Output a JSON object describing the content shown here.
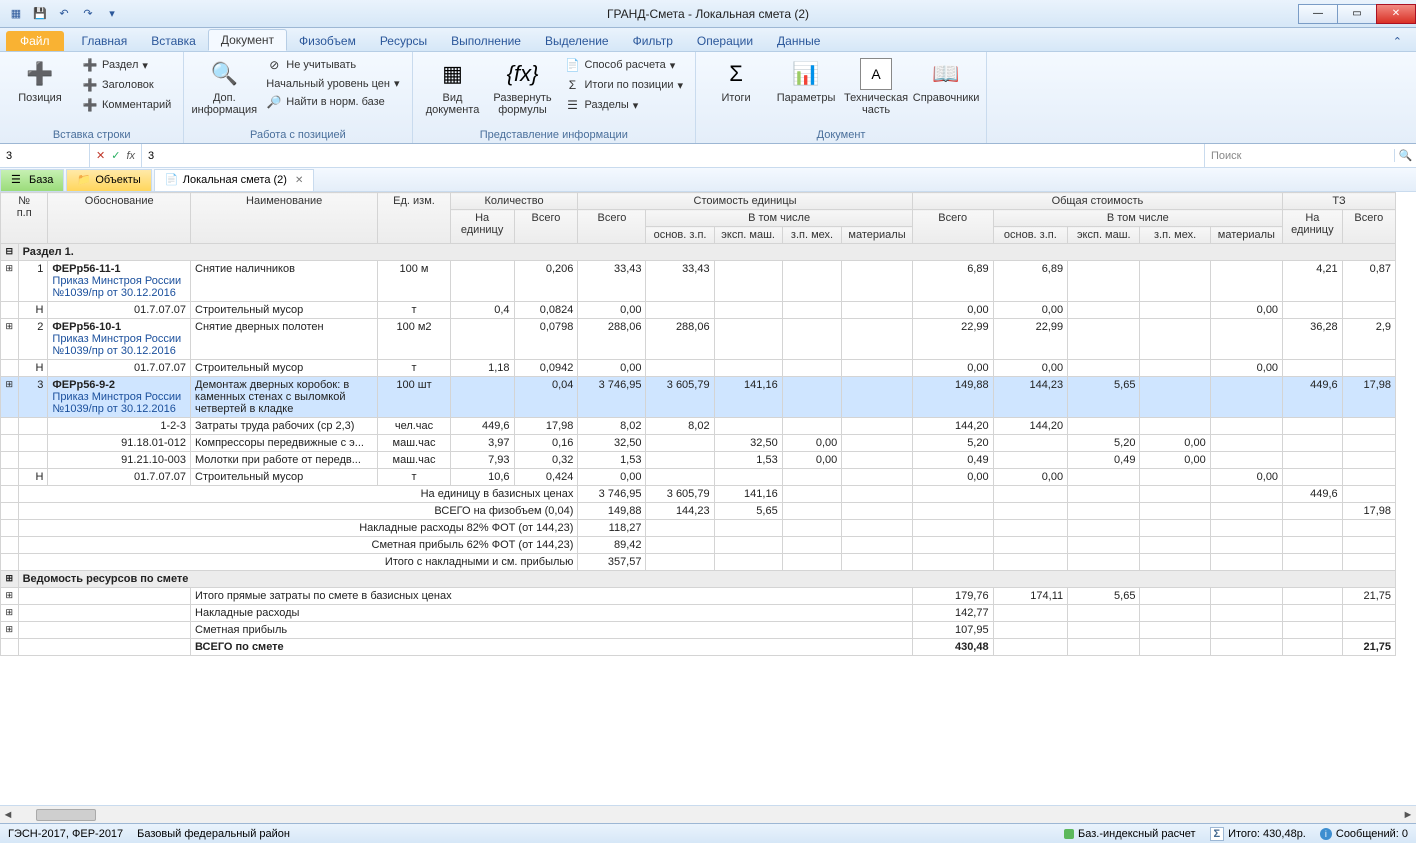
{
  "title": "ГРАНД-Смета - Локальная смета (2)",
  "ribbon_tabs": {
    "file": "Файл",
    "items": [
      "Главная",
      "Вставка",
      "Документ",
      "Физобъем",
      "Ресурсы",
      "Выполнение",
      "Выделение",
      "Фильтр",
      "Операции",
      "Данные"
    ],
    "active": 2
  },
  "ribbon": {
    "g1": {
      "label": "Вставка строки",
      "pos": "Позиция",
      "razdel": "Раздел",
      "zag": "Заголовок",
      "komm": "Комментарий"
    },
    "g2": {
      "label": "Работа с позицией",
      "dopinfo": "Доп.\nинформация",
      "neuch": "Не учитывать",
      "nachur": "Начальный уровень цен",
      "najti": "Найти в норм. базе"
    },
    "g3": {
      "label": "Представление информации",
      "viddoc": "Вид\nдокумента",
      "razv": "Развернуть\nформулы",
      "sposob": "Способ расчета",
      "itogipoz": "Итоги по позиции",
      "razdely": "Разделы"
    },
    "g4": {
      "label": "Документ",
      "itogi": "Итоги",
      "param": "Параметры",
      "tech": "Техническая\nчасть",
      "sprav": "Справочники"
    }
  },
  "formula": {
    "ref": "3",
    "value": "3",
    "search_ph": "Поиск"
  },
  "doctabs": {
    "baza": "База",
    "obj": "Объекты",
    "doc": "Локальная смета (2)"
  },
  "headers": {
    "npp": "№\nп.п",
    "obosn": "Обоснование",
    "naim": "Наименование",
    "ed": "Ед. изм.",
    "kol": "Количество",
    "kol_ed": "На единицу",
    "kol_vsego": "Всего",
    "stoim_ed": "Стоимость единицы",
    "obsh": "Общая стоимость",
    "vtom": "В том числе",
    "vsego": "Всего",
    "osnov": "основ. з.п.",
    "eksp": "эксп. маш.",
    "zpmeh": "з.п. мех.",
    "mat": "материалы",
    "tz": "ТЗ",
    "tz_ed": "На единицу",
    "tz_vsego": "Всего"
  },
  "section1": "Раздел 1.",
  "rows": [
    {
      "n": "1",
      "code": "ФЕРр56-11-1",
      "order": "Приказ Минстроя России №1039/пр от 30.12.2016",
      "name": "Снятие наличников",
      "ed": "100 м",
      "kv": "0,206",
      "sv": "33,43",
      "so": "33,43",
      "ov": "6,89",
      "oo": "6,89",
      "te": "4,21",
      "tv": "0,87"
    },
    {
      "type": "sub",
      "h": "H",
      "code": "01.7.07.07",
      "name": "Строительный мусор",
      "ed": "т",
      "ke": "0,4",
      "kv": "0,0824",
      "sv": "0,00",
      "ov": "0,00",
      "oo": "0,00",
      "om": "0,00"
    },
    {
      "n": "2",
      "code": "ФЕРр56-10-1",
      "order": "Приказ Минстроя России №1039/пр от 30.12.2016",
      "name": "Снятие дверных полотен",
      "ed": "100 м2",
      "kv": "0,0798",
      "sv": "288,06",
      "so": "288,06",
      "ov": "22,99",
      "oo": "22,99",
      "te": "36,28",
      "tv": "2,9"
    },
    {
      "type": "sub",
      "h": "H",
      "code": "01.7.07.07",
      "name": "Строительный мусор",
      "ed": "т",
      "ke": "1,18",
      "kv": "0,0942",
      "sv": "0,00",
      "ov": "0,00",
      "oo": "0,00",
      "om": "0,00"
    },
    {
      "sel": true,
      "n": "3",
      "code": "ФЕРр56-9-2",
      "order": "Приказ Минстроя России №1039/пр от 30.12.2016",
      "name": "Демонтаж дверных коробок: в каменных стенах с выломкой четвертей в кладке",
      "ed": "100 шт",
      "kv": "0,04",
      "sv": "3 746,95",
      "so": "3 605,79",
      "se": "141,16",
      "ov": "149,88",
      "oo": "144,23",
      "oe": "5,65",
      "te": "449,6",
      "tv": "17,98"
    },
    {
      "type": "sub2",
      "code": "1-2-3",
      "name": "Затраты труда рабочих (ср 2,3)",
      "ed": "чел.час",
      "ke": "449,6",
      "kv": "17,98",
      "sv": "8,02",
      "so": "8,02",
      "ov": "144,20",
      "oo": "144,20"
    },
    {
      "type": "sub2",
      "code": "91.18.01-012",
      "name": "Компрессоры передвижные с э...",
      "ed": "маш.час",
      "ke": "3,97",
      "kv": "0,16",
      "sv": "32,50",
      "se": "32,50",
      "sz": "0,00",
      "ov": "5,20",
      "oe": "5,20",
      "oz": "0,00"
    },
    {
      "type": "sub2",
      "code": "91.21.10-003",
      "name": "Молотки при работе от передв...",
      "ed": "маш.час",
      "ke": "7,93",
      "kv": "0,32",
      "sv": "1,53",
      "se": "1,53",
      "sz": "0,00",
      "ov": "0,49",
      "oe": "0,49",
      "oz": "0,00"
    },
    {
      "type": "sub",
      "h": "H",
      "code": "01.7.07.07",
      "name": "Строительный мусор",
      "ed": "т",
      "ke": "10,6",
      "kv": "0,424",
      "sv": "0,00",
      "ov": "0,00",
      "oo": "0,00",
      "om": "0,00"
    }
  ],
  "summaries": [
    {
      "label": "На единицу в базисных ценах",
      "sv": "3 746,95",
      "so": "3 605,79",
      "se": "141,16",
      "te": "449,6"
    },
    {
      "label": "ВСЕГО на физобъем (0,04)",
      "sv": "149,88",
      "so": "144,23",
      "se": "5,65",
      "tv": "17,98"
    },
    {
      "label": "Накладные расходы 82% ФОТ (от 144,23)",
      "sv": "118,27"
    },
    {
      "label": "Сметная прибыль 62% ФОТ (от 144,23)",
      "sv": "89,42"
    },
    {
      "label": "Итого с накладными и см. прибылью",
      "sv": "357,57"
    }
  ],
  "vedomost": "Ведомость ресурсов по смете",
  "totals": [
    {
      "label": "Итого прямые затраты по смете в базисных ценах",
      "ov": "179,76",
      "oo": "174,11",
      "oe": "5,65",
      "tv": "21,75"
    },
    {
      "label": "Накладные расходы",
      "ov": "142,77"
    },
    {
      "label": "Сметная прибыль",
      "ov": "107,95"
    },
    {
      "label": "ВСЕГО по смете",
      "ov": "430,48",
      "tv": "21,75",
      "strong": true
    }
  ],
  "status": {
    "left1": "ГЭСН-2017, ФЕР-2017",
    "left2": "Базовый федеральный район",
    "calc": "Баз.-индексный расчет",
    "itogo": "Итого: 430,48р.",
    "msg": "Сообщений: 0"
  }
}
